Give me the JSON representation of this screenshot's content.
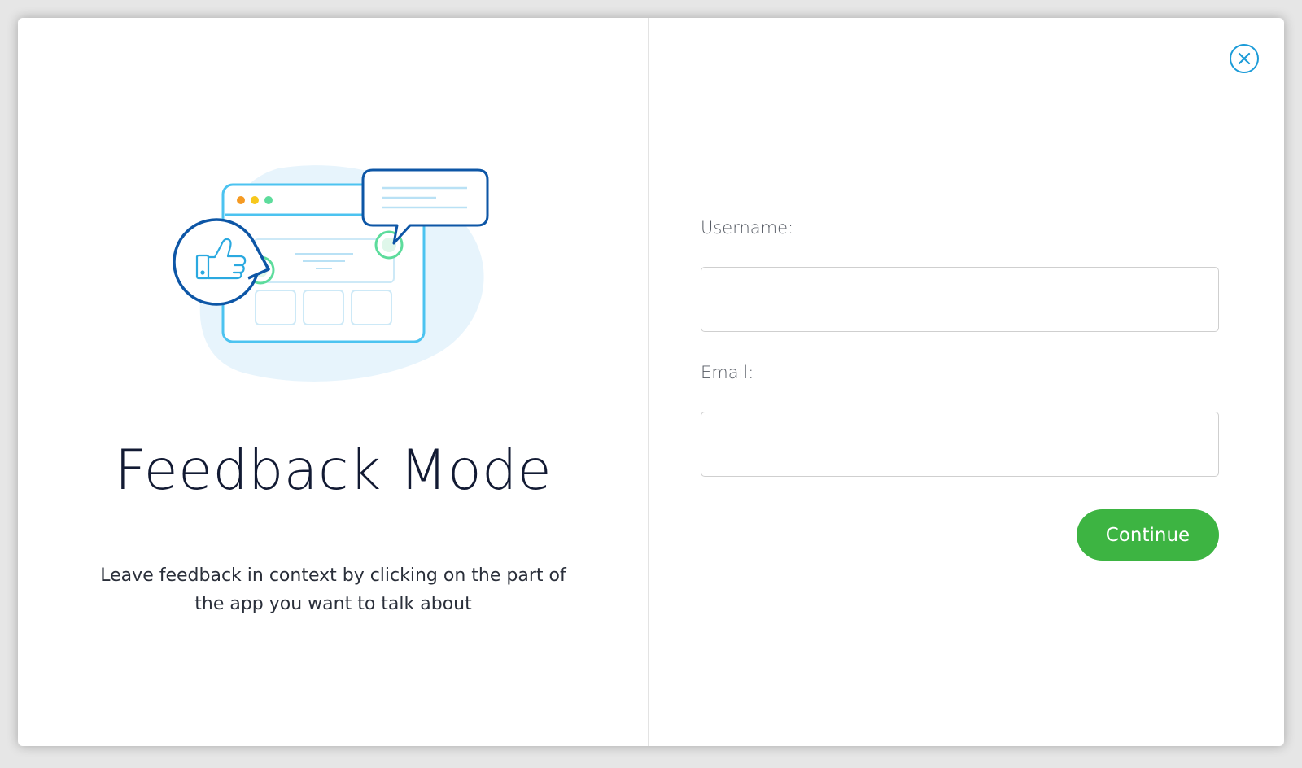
{
  "feedback": {
    "title": "Feedback Mode",
    "description": "Leave feedback in context by clicking on the part of the app you want to talk about"
  },
  "form": {
    "username_label": "Username:",
    "username_value": "",
    "email_label": "Email:",
    "email_value": "",
    "continue_label": "Continue"
  },
  "icons": {
    "close": "close-icon",
    "illustration": "feedback-illustration",
    "thumbs_up": "thumbs-up-icon"
  },
  "colors": {
    "accent_blue": "#1b9bd8",
    "dark_blue": "#0d56a6",
    "light_blue": "#4cc3f0",
    "green": "#3db442",
    "mint": "#5ddc9c",
    "title_text": "#121a33"
  }
}
